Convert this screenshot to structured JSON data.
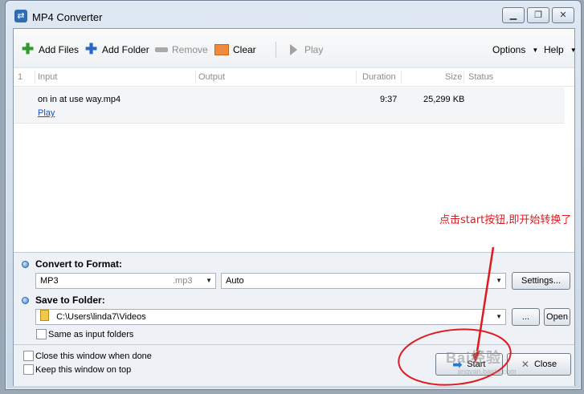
{
  "window": {
    "title": "MP4 Converter",
    "app_icon": "swap-arrows-icon",
    "controls": [
      "minimize",
      "restore",
      "close"
    ]
  },
  "toolbar": {
    "add_files": "Add Files",
    "add_folder": "Add Folder",
    "remove": "Remove",
    "clear": "Clear",
    "play": "Play",
    "options": "Options",
    "help": "Help"
  },
  "grid": {
    "headers": {
      "index": "1",
      "input": "Input",
      "output": "Output",
      "duration": "Duration",
      "size": "Size",
      "status": "Status"
    },
    "rows": [
      {
        "input": "on in at use way.mp4",
        "play_link": "Play",
        "output": "",
        "duration": "9:37",
        "size": "25,299 KB",
        "status": ""
      }
    ]
  },
  "convert": {
    "label": "Convert to Format:",
    "format": "MP3",
    "extension": ".mp3",
    "quality": "Auto",
    "settings_button": "Settings..."
  },
  "save": {
    "label": "Save to Folder:",
    "path": "C:\\Users\\linda7\\Videos",
    "browse_button": "...",
    "open_button": "Open",
    "same_as_input": "Same as input folders"
  },
  "bottom": {
    "close_when_done": "Close this window when done",
    "keep_on_top": "Keep this window on top",
    "start_button": "Start",
    "close_button": "Close"
  },
  "annotation": {
    "text": "点击start按钮,即开始转换了",
    "color": "#e0191f"
  },
  "watermark": {
    "text": "Bai经验",
    "sub": "jingyan.baidu.com"
  },
  "colors": {
    "accent_blue": "#2a68c8",
    "add_green": "#2f9a2f",
    "clear_orange": "#f08a3c",
    "annotation_red": "#e0191f"
  }
}
